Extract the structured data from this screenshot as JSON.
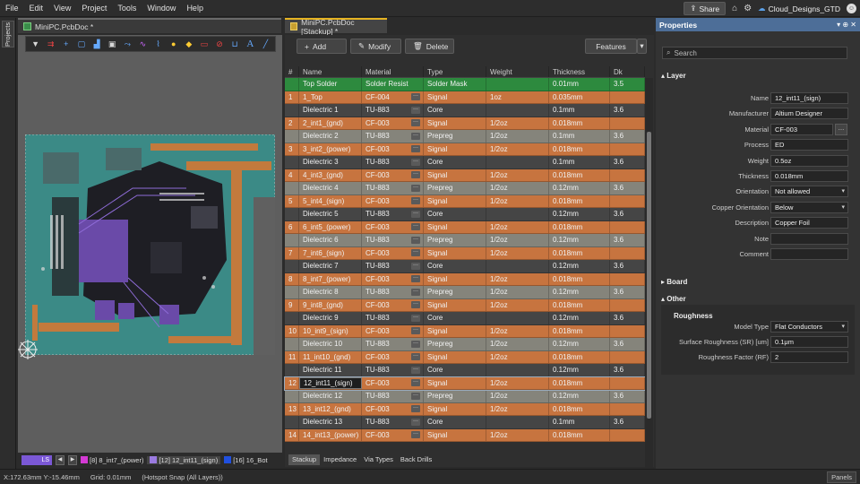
{
  "menu": [
    "File",
    "Edit",
    "View",
    "Project",
    "Tools",
    "Window",
    "Help"
  ],
  "topright": {
    "share": "Share",
    "account": "Cloud_Designs_GTD"
  },
  "left_rail": {
    "projects": "Projects"
  },
  "tabs": {
    "pcb": "MiniPC.PcbDoc *",
    "stack": "MiniPC.PcbDoc [Stackup] *"
  },
  "stack_toolbar": {
    "add": "Add",
    "modify": "Modify",
    "delete": "Delete",
    "features": "Features"
  },
  "columns": [
    "#",
    "Name",
    "Material",
    "Type",
    "Weight",
    "Thickness",
    "Dk"
  ],
  "rows": [
    {
      "num": "",
      "name": "Top Solder",
      "material": "Solder Resist",
      "type": "Solder Mask",
      "weight": "",
      "thickness": "0.01mm",
      "dk": "3.5",
      "kind": "top"
    },
    {
      "num": "1",
      "name": "1_Top",
      "material": "CF-004",
      "type": "Signal",
      "weight": "1oz",
      "thickness": "0.035mm",
      "dk": "",
      "kind": "sig"
    },
    {
      "num": "",
      "name": "Dielectric 1",
      "material": "TU-883",
      "type": "Core",
      "weight": "",
      "thickness": "0.1mm",
      "dk": "3.6",
      "kind": "core"
    },
    {
      "num": "2",
      "name": "2_int1_(gnd)",
      "material": "CF-003",
      "type": "Signal",
      "weight": "1/2oz",
      "thickness": "0.018mm",
      "dk": "",
      "kind": "sig"
    },
    {
      "num": "",
      "name": "Dielectric 2",
      "material": "TU-883",
      "type": "Prepreg",
      "weight": "1/2oz",
      "thickness": "0.1mm",
      "dk": "3.6",
      "kind": "pre"
    },
    {
      "num": "3",
      "name": "3_int2_(power)",
      "material": "CF-003",
      "type": "Signal",
      "weight": "1/2oz",
      "thickness": "0.018mm",
      "dk": "",
      "kind": "sig"
    },
    {
      "num": "",
      "name": "Dielectric 3",
      "material": "TU-883",
      "type": "Core",
      "weight": "",
      "thickness": "0.1mm",
      "dk": "3.6",
      "kind": "core"
    },
    {
      "num": "4",
      "name": "4_int3_(gnd)",
      "material": "CF-003",
      "type": "Signal",
      "weight": "1/2oz",
      "thickness": "0.018mm",
      "dk": "",
      "kind": "sig"
    },
    {
      "num": "",
      "name": "Dielectric 4",
      "material": "TU-883",
      "type": "Prepreg",
      "weight": "1/2oz",
      "thickness": "0.12mm",
      "dk": "3.6",
      "kind": "pre"
    },
    {
      "num": "5",
      "name": "5_int4_(sign)",
      "material": "CF-003",
      "type": "Signal",
      "weight": "1/2oz",
      "thickness": "0.018mm",
      "dk": "",
      "kind": "sig"
    },
    {
      "num": "",
      "name": "Dielectric 5",
      "material": "TU-883",
      "type": "Core",
      "weight": "",
      "thickness": "0.12mm",
      "dk": "3.6",
      "kind": "core"
    },
    {
      "num": "6",
      "name": "6_int5_(power)",
      "material": "CF-003",
      "type": "Signal",
      "weight": "1/2oz",
      "thickness": "0.018mm",
      "dk": "",
      "kind": "sig"
    },
    {
      "num": "",
      "name": "Dielectric 6",
      "material": "TU-883",
      "type": "Prepreg",
      "weight": "1/2oz",
      "thickness": "0.12mm",
      "dk": "3.6",
      "kind": "pre"
    },
    {
      "num": "7",
      "name": "7_int6_(sign)",
      "material": "CF-003",
      "type": "Signal",
      "weight": "1/2oz",
      "thickness": "0.018mm",
      "dk": "",
      "kind": "sig"
    },
    {
      "num": "",
      "name": "Dielectric 7",
      "material": "TU-883",
      "type": "Core",
      "weight": "",
      "thickness": "0.12mm",
      "dk": "3.6",
      "kind": "core"
    },
    {
      "num": "8",
      "name": "8_int7_(power)",
      "material": "CF-003",
      "type": "Signal",
      "weight": "1/2oz",
      "thickness": "0.018mm",
      "dk": "",
      "kind": "sig"
    },
    {
      "num": "",
      "name": "Dielectric 8",
      "material": "TU-883",
      "type": "Prepreg",
      "weight": "1/2oz",
      "thickness": "0.12mm",
      "dk": "3.6",
      "kind": "pre"
    },
    {
      "num": "9",
      "name": "9_int8_(gnd)",
      "material": "CF-003",
      "type": "Signal",
      "weight": "1/2oz",
      "thickness": "0.018mm",
      "dk": "",
      "kind": "sig"
    },
    {
      "num": "",
      "name": "Dielectric 9",
      "material": "TU-883",
      "type": "Core",
      "weight": "",
      "thickness": "0.12mm",
      "dk": "3.6",
      "kind": "core"
    },
    {
      "num": "10",
      "name": "10_int9_(sign)",
      "material": "CF-003",
      "type": "Signal",
      "weight": "1/2oz",
      "thickness": "0.018mm",
      "dk": "",
      "kind": "sig"
    },
    {
      "num": "",
      "name": "Dielectric 10",
      "material": "TU-883",
      "type": "Prepreg",
      "weight": "1/2oz",
      "thickness": "0.12mm",
      "dk": "3.6",
      "kind": "pre"
    },
    {
      "num": "11",
      "name": "11_int10_(gnd)",
      "material": "CF-003",
      "type": "Signal",
      "weight": "1/2oz",
      "thickness": "0.018mm",
      "dk": "",
      "kind": "sig"
    },
    {
      "num": "",
      "name": "Dielectric 11",
      "material": "TU-883",
      "type": "Core",
      "weight": "",
      "thickness": "0.12mm",
      "dk": "3.6",
      "kind": "core"
    },
    {
      "num": "12",
      "name": "12_int11_(sign)",
      "material": "CF-003",
      "type": "Signal",
      "weight": "1/2oz",
      "thickness": "0.018mm",
      "dk": "",
      "kind": "sel"
    },
    {
      "num": "",
      "name": "Dielectric 12",
      "material": "TU-883",
      "type": "Prepreg",
      "weight": "1/2oz",
      "thickness": "0.12mm",
      "dk": "3.6",
      "kind": "pre"
    },
    {
      "num": "13",
      "name": "13_int12_(gnd)",
      "material": "CF-003",
      "type": "Signal",
      "weight": "1/2oz",
      "thickness": "0.018mm",
      "dk": "",
      "kind": "sig"
    },
    {
      "num": "",
      "name": "Dielectric 13",
      "material": "TU-883",
      "type": "Core",
      "weight": "",
      "thickness": "0.1mm",
      "dk": "3.6",
      "kind": "core"
    },
    {
      "num": "14",
      "name": "14_int13_(power)",
      "material": "CF-003",
      "type": "Signal",
      "weight": "1/2oz",
      "thickness": "0.018mm",
      "dk": "",
      "kind": "sig"
    }
  ],
  "bottom_tabs": [
    "Stackup",
    "Impedance",
    "Via Types",
    "Back Drills"
  ],
  "layer_bar": {
    "ls": "LS",
    "l1": "[8] 8_int7_(power)",
    "l2": "[12] 12_int11_(sign)",
    "l3": "[16] 16_Bot"
  },
  "props": {
    "title": "Properties",
    "search": "Search",
    "layer_section": "Layer",
    "fields": [
      {
        "label": "Name",
        "value": "12_int11_(sign)"
      },
      {
        "label": "Manufacturer",
        "value": "Altium Designer"
      },
      {
        "label": "Material",
        "value": "CF-003"
      },
      {
        "label": "Process",
        "value": "ED"
      },
      {
        "label": "Weight",
        "value": "0.5oz"
      },
      {
        "label": "Thickness",
        "value": "0.018mm"
      },
      {
        "label": "Orientation",
        "value": "Not allowed"
      },
      {
        "label": "Copper Orientation",
        "value": "Below"
      },
      {
        "label": "Description",
        "value": "Copper Foil"
      },
      {
        "label": "Note",
        "value": ""
      },
      {
        "label": "Comment",
        "value": ""
      }
    ],
    "board_section": "Board",
    "other_section": "Other",
    "roughness_title": "Roughness",
    "rough_fields": [
      {
        "label": "Model Type",
        "value": "Flat Conductors"
      },
      {
        "label": "Surface Roughness (SR) [um]",
        "value": "0.1μm"
      },
      {
        "label": "Roughness Factor (RF)",
        "value": "2"
      }
    ]
  },
  "status": {
    "coords": "X:172.63mm Y:-15.46mm",
    "grid": "Grid: 0.01mm",
    "snap": "(Hotspot Snap (All Layers))",
    "panels": "Panels"
  },
  "colors": {
    "signal": "#c7743f",
    "core": "#454545",
    "prepreg": "#85847b",
    "top": "#2d8a3e",
    "accent": "#4d6e98"
  }
}
